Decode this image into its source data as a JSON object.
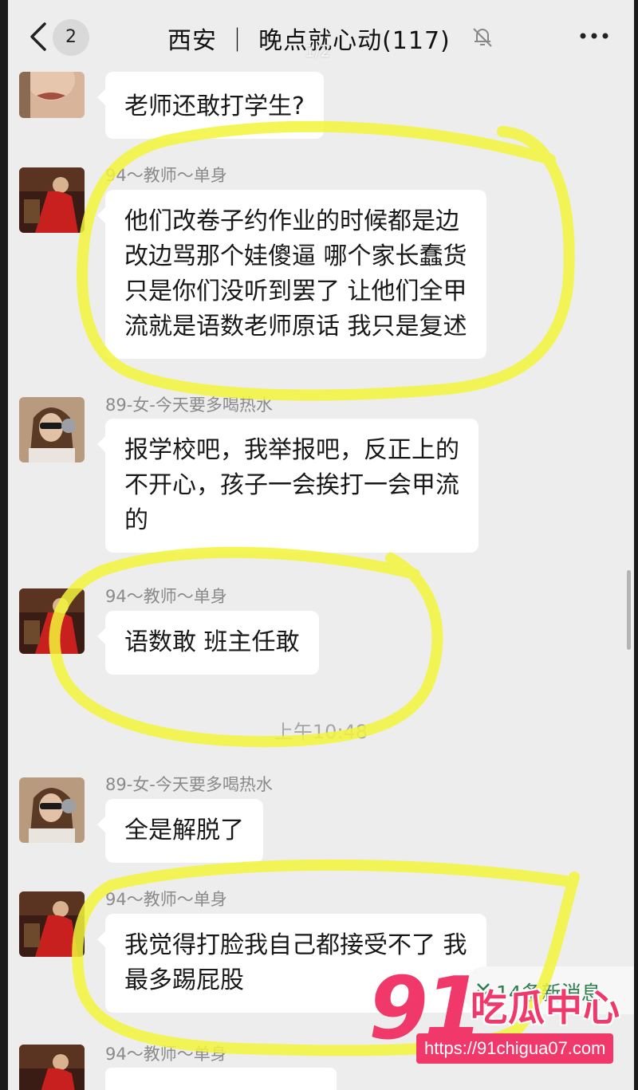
{
  "header": {
    "unread_count": "2",
    "title": "西安 ｜ 晚点就心动(117)",
    "page_indicator": "1/2"
  },
  "messages": [
    {
      "sender": "",
      "lines": [
        "老师还敢打学生?"
      ]
    },
    {
      "sender": "94～教师～单身",
      "lines": [
        "他们改卷子约作业的时候都是边",
        "改边骂那个娃傻逼 哪个家长蠢货",
        "只是你们没听到罢了 让他们全甲",
        "流就是语数老师原话 我只是复述"
      ]
    },
    {
      "sender": "89-女-今天要多喝热水",
      "lines": [
        "报学校吧，我举报吧，反正上的",
        "不开心，孩子一会挨打一会甲流",
        "的"
      ]
    },
    {
      "sender": "94～教师～单身",
      "lines": [
        "语数敢 班主任敢"
      ]
    },
    {
      "sender": "89-女-今天要多喝热水",
      "lines": [
        "全是解脱了"
      ]
    },
    {
      "sender": "94～教师～单身",
      "lines": [
        "我觉得打脸我自己都接受不了 我",
        "最多踢屁股"
      ]
    },
    {
      "sender": "94～教师～单身",
      "lines": []
    }
  ],
  "timestamp": "上午10:48",
  "new_messages": "14条新消息",
  "watermark": {
    "logo": "91",
    "brand": "吃瓜中心",
    "url": "https://91chigua07.com"
  },
  "colors": {
    "highlight": "#f2f53a",
    "brand": "#f0386b",
    "background": "#ededed",
    "new_messages_text": "#2e7d4f"
  },
  "icons": [
    "chevron-left-icon",
    "bell-off-icon",
    "more-icon",
    "double-chevron-down-icon"
  ]
}
